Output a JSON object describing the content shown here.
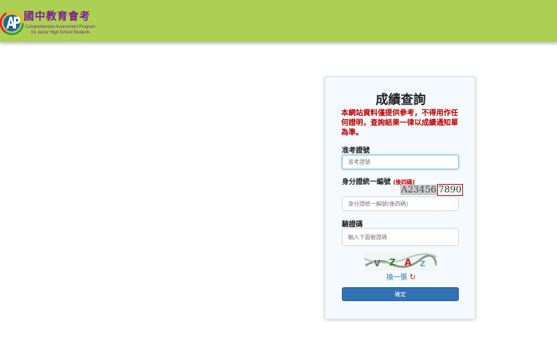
{
  "header": {
    "logo_title": "國中教育會考",
    "logo_sub1": "Comprehensive Assessment Program",
    "logo_sub2": "for Junior High School Students"
  },
  "form": {
    "title": "成績查詢",
    "notice": "本網站資料僅提供參考，不得用作任何證明，查詢結果一律以成績通知單為準。",
    "exam_no": {
      "label": "准考證號",
      "placeholder": "准考證號",
      "value": ""
    },
    "id_no": {
      "label": "身分證統一編號",
      "hint": "(後四碼)",
      "sample_head": "A23456",
      "sample_tail": "7890",
      "placeholder": "身分證統一編號(後四碼)",
      "value": ""
    },
    "captcha": {
      "label": "驗證碼",
      "placeholder": "輸入下面驗證碼",
      "value": "",
      "image_chars": [
        "V",
        "Z",
        "A",
        "Z"
      ],
      "refresh_label": "換一張",
      "refresh_icon": "refresh-icon"
    },
    "submit_label": "確定"
  },
  "colors": {
    "header_bg": "#acd054",
    "brand": "#7a1f8a",
    "warning": "#c00000",
    "button": "#2f73b5"
  }
}
